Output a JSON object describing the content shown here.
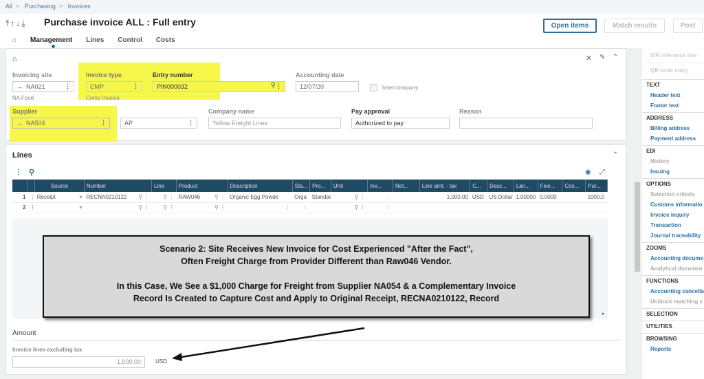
{
  "breadcrumb": [
    "All",
    "Purchasing",
    "Invoices"
  ],
  "header": {
    "title": "Purchase invoice ALL : Full entry",
    "nav_arrows": "⤒↑↓⤓",
    "tabs": [
      "Management",
      "Lines",
      "Control",
      "Costs"
    ],
    "buttons": {
      "open_items": "Open items",
      "match_results": "Match results",
      "post": "Post"
    }
  },
  "form": {
    "invoicing_site": {
      "label": "Invoicing site",
      "value": "NA021",
      "desc": "NA Food"
    },
    "invoice_type": {
      "label": "Invoice type",
      "value": "CMP",
      "desc": "Comp Invoice"
    },
    "entry_number": {
      "label": "Entry number",
      "value": "PIN000032"
    },
    "accounting_date": {
      "label": "Accounting date",
      "value": "12/07/20"
    },
    "intercompany": {
      "label": "Intercompany",
      "checked": false
    },
    "supplier": {
      "label": "Supplier",
      "value": "NA504"
    },
    "supplier_type": {
      "value": "AP"
    },
    "company_name": {
      "label": "Company name",
      "value": "Yellow Freight Lines"
    },
    "pay_approval": {
      "label": "Pay approval",
      "value": "Authorized to pay"
    },
    "reason": {
      "label": "Reason",
      "value": ""
    }
  },
  "lines": {
    "title": "Lines",
    "columns": [
      "",
      "",
      "Source",
      "Number",
      "Line",
      "Product",
      "Description",
      "Sta...",
      "Pro...",
      "Unit",
      "Inv...",
      "Net...",
      "Line amt. - tax",
      "C...",
      "Desc...",
      "Lan...",
      "Fixe...",
      "Cos...",
      "Pur..."
    ],
    "rows": [
      {
        "num": "1",
        "source": "Receipt",
        "number": "RECNA0210122",
        "line": "",
        "product": "RAW046",
        "description": "Organic Egg Powde",
        "sta": "Orga",
        "pro": "Standar",
        "unit": "",
        "inv": "",
        "net": "",
        "amount": "1,000.00",
        "cur": "USD",
        "desc": "US Dollar",
        "lan": "1.00000",
        "fixe": "0.0000",
        "cos": "",
        "pur": "1000.0"
      },
      {
        "num": "2",
        "source": "",
        "number": "",
        "line": "",
        "product": "",
        "description": "",
        "sta": "",
        "pro": "",
        "unit": "",
        "inv": "",
        "net": "",
        "amount": "",
        "cur": "",
        "desc": "",
        "lan": "",
        "fixe": "",
        "cos": "",
        "pur": ""
      }
    ]
  },
  "callout": {
    "line1": "Scenario 2: Site Receives New Invoice for Cost Experienced \"After the Fact\",",
    "line2": "Often Freight Charge from Provider Different than Raw046 Vendor.",
    "line3": "In this Case, We See a $1,000 Charge for Freight from Supplier NA054 & a Complementary Invoice",
    "line4": "Record Is Created to Capture Cost and Apply to Original Receipt, RECNA0210122, Record"
  },
  "amount": {
    "title": "Amount",
    "label": "Invoice lines excluding tax",
    "value": "1,000.00",
    "currency": "USD"
  },
  "sidebar": {
    "top": [
      "ISR reference line",
      "QR code entry"
    ],
    "sections": [
      {
        "title": "TEXT",
        "items": [
          {
            "label": "Header text",
            "state": "active"
          },
          {
            "label": "Footer text",
            "state": "active"
          }
        ]
      },
      {
        "title": "ADDRESS",
        "items": [
          {
            "label": "Billing address",
            "state": "active"
          },
          {
            "label": "Payment address",
            "state": "active"
          }
        ]
      },
      {
        "title": "EDI",
        "items": [
          {
            "label": "History",
            "state": "disabled"
          },
          {
            "label": "Issuing",
            "state": "active"
          }
        ]
      },
      {
        "title": "OPTIONS",
        "items": [
          {
            "label": "Selection criteria",
            "state": "disabled"
          },
          {
            "label": "Customs informatio",
            "state": "active"
          },
          {
            "label": "Invoice inquiry",
            "state": "active"
          },
          {
            "label": "Transaction",
            "state": "active"
          },
          {
            "label": "Journal traceability",
            "state": "active"
          }
        ]
      },
      {
        "title": "ZOOMS",
        "items": [
          {
            "label": "Accounting docume",
            "state": "active"
          },
          {
            "label": "Analytical documen",
            "state": "disabled"
          }
        ]
      },
      {
        "title": "FUNCTIONS",
        "items": [
          {
            "label": "Accounting cancella",
            "state": "active"
          },
          {
            "label": "Unblock matching e",
            "state": "disabled"
          }
        ]
      },
      {
        "title": "SELECTION",
        "items": []
      },
      {
        "title": "UTILITIES",
        "items": []
      },
      {
        "title": "BROWSING",
        "items": [
          {
            "label": "Reports",
            "state": "active"
          }
        ]
      }
    ]
  }
}
